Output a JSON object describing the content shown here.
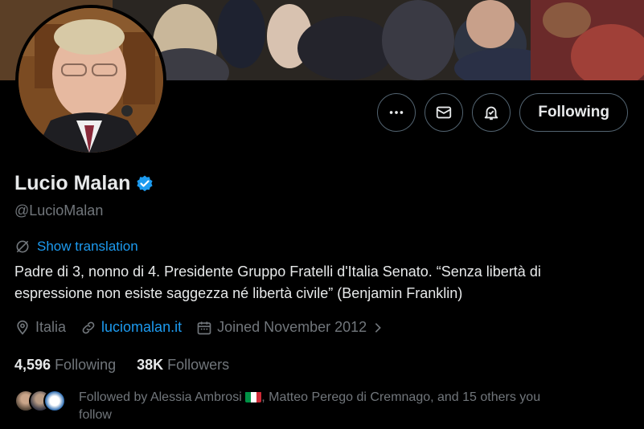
{
  "profile": {
    "name": "Lucio Malan",
    "handle": "@LucioMalan",
    "show_translation": "Show translation",
    "bio_line1": "Padre di 3, nonno di 4. Presidente Gruppo Fratelli d'Italia Senato. “Senza libertà di",
    "bio_line2": "espressione non esiste saggezza né libertà civile” (Benjamin Franklin)",
    "location": "Italia",
    "website": "luciomalan.it",
    "joined": "Joined November 2012"
  },
  "actions": {
    "following_label": "Following"
  },
  "stats": {
    "following_count": "4,596",
    "following_label": "Following",
    "followers_count": "38K",
    "followers_label": "Followers"
  },
  "followed_by": {
    "prefix": "Followed by Alessia Ambrosi",
    "suffix": ", Matteo Perego di Cremnago, and 15 others you",
    "line2": "follow"
  },
  "colors": {
    "accent": "#1d9bf0",
    "verified": "#1d9bf0",
    "secondary_text": "#71767b"
  },
  "icons": [
    "more-icon",
    "mail-icon",
    "notification-bell-icon",
    "verified-badge-icon",
    "translate-icon",
    "location-icon",
    "link-icon",
    "calendar-icon",
    "chevron-right-icon"
  ]
}
